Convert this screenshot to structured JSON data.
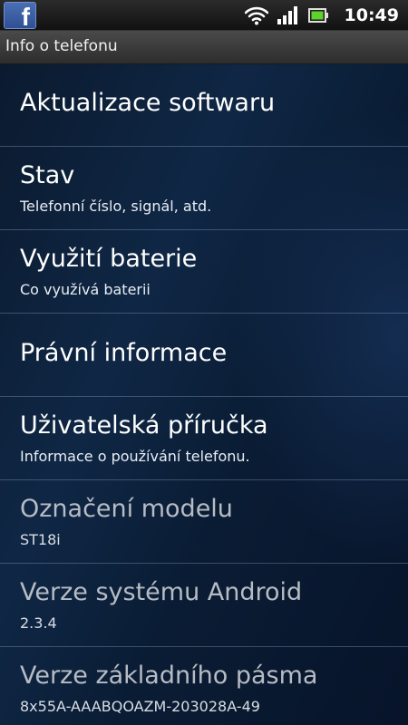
{
  "status_bar": {
    "notification_icon": "facebook-icon",
    "notification_glyph": "f",
    "icons": [
      "wifi-icon",
      "signal-icon",
      "battery-icon"
    ],
    "time": "10:49"
  },
  "header": {
    "title": "Info o telefonu"
  },
  "items": [
    {
      "title": "Aktualizace softwaru",
      "subtitle": ""
    },
    {
      "title": "Stav",
      "subtitle": "Telefonní číslo, signál, atd."
    },
    {
      "title": "Využití baterie",
      "subtitle": "Co využívá baterii"
    },
    {
      "title": "Právní informace",
      "subtitle": ""
    },
    {
      "title": "Uživatelská příručka",
      "subtitle": "Informace o používání telefonu."
    },
    {
      "title": "Označení modelu",
      "subtitle": "ST18i"
    },
    {
      "title": "Verze systému Android",
      "subtitle": "2.3.4"
    },
    {
      "title": "Verze základního pásma",
      "subtitle": "8x55A-AAABQOAZM-203028A-49"
    }
  ],
  "colors": {
    "accent_battery": "#5fd32a",
    "list_background": "#0f2745",
    "divider": "#8ea4c0"
  }
}
